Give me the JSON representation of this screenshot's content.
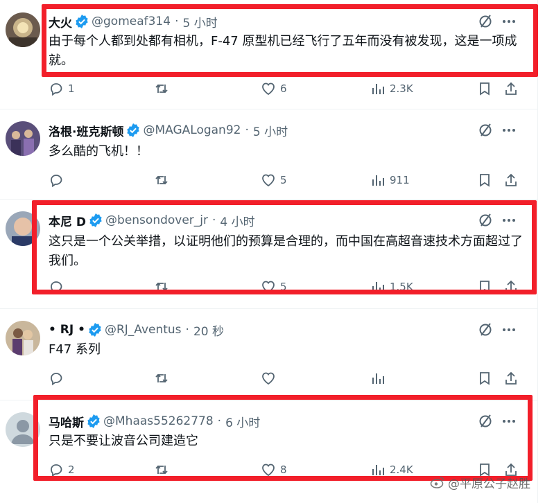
{
  "tweets": [
    {
      "name": "大火",
      "handle": "@gomeaf314",
      "separator": "·",
      "time": "5 小时",
      "text": "由于每个人都到处都有相机，F-47 原型机已经飞行了五年而没有被发现，这是一项成就。",
      "replies": "1",
      "retweets": "",
      "likes": "6",
      "views": "2.3K",
      "highlighted": true
    },
    {
      "name": "洛根·班克斯顿",
      "handle": "@MAGALogan92",
      "separator": "·",
      "time": "5 小时",
      "text": "多么酷的飞机！！",
      "replies": "",
      "retweets": "",
      "likes": "5",
      "views": "911",
      "highlighted": false
    },
    {
      "name": "本尼 D",
      "handle": "@bensondover_jr",
      "separator": "·",
      "time": "4 小时",
      "text": "这只是一个公关举措，以证明他们的预算是合理的，而中国在高超音速技术方面超过了我们。",
      "replies": "",
      "retweets": "",
      "likes": "5",
      "views": "1.5K",
      "highlighted": true
    },
    {
      "name": "• RJ •",
      "handle": "@RJ_Aventus",
      "separator": "·",
      "time": "20 秒",
      "text": "F47 系列",
      "replies": "",
      "retweets": "",
      "likes": "",
      "views": "",
      "highlighted": false
    },
    {
      "name": "马哈斯",
      "handle": "@Mhaas55262778",
      "separator": "·",
      "time": "6 小时",
      "text": "只是不要让波音公司建造它",
      "replies": "2",
      "retweets": "",
      "likes": "8",
      "views": "2.4K",
      "highlighted": true
    }
  ],
  "watermark": "@平原公子赵胜",
  "colors": {
    "highlight": "#f21f2a",
    "verified": "#1d9bf0",
    "secondary_text": "#536471"
  }
}
